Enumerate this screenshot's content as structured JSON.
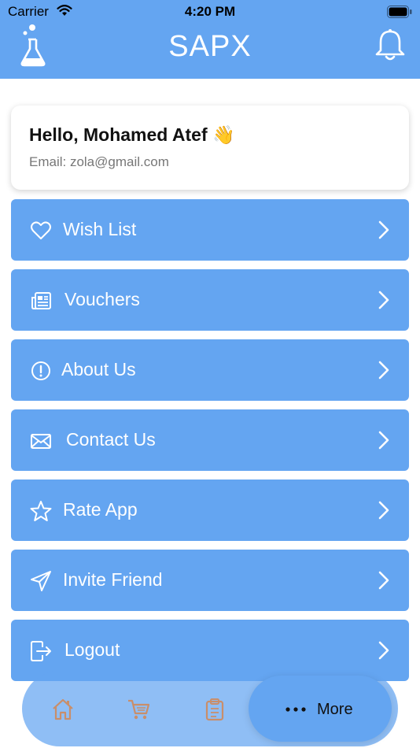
{
  "status_bar": {
    "carrier": "Carrier",
    "time": "4:20 PM"
  },
  "header": {
    "title": "SAPX"
  },
  "profile": {
    "greeting": "Hello, Mohamed Atef 👋",
    "email": "Email: zola@gmail.com"
  },
  "menu": {
    "items": [
      {
        "label": "Wish List",
        "icon": "heart-icon"
      },
      {
        "label": "Vouchers",
        "icon": "newspaper-icon"
      },
      {
        "label": "About Us",
        "icon": "info-circle-icon"
      },
      {
        "label": "Contact Us",
        "icon": "envelope-icon"
      },
      {
        "label": "Rate App",
        "icon": "star-icon"
      },
      {
        "label": "Invite Friend",
        "icon": "send-icon"
      },
      {
        "label": "Logout",
        "icon": "logout-icon"
      }
    ]
  },
  "tabbar": {
    "tabs": [
      "home-icon",
      "cart-icon",
      "clipboard-icon"
    ],
    "more_label": "More"
  },
  "colors": {
    "accent": "#64a5f1",
    "tab_icon": "#c98e6a"
  }
}
